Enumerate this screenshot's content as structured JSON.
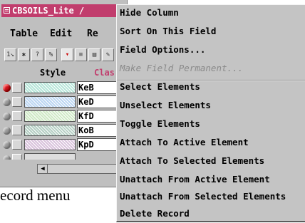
{
  "window": {
    "title": "CBSOILS_Lite /",
    "menu": [
      "Table",
      "Edit",
      "Re"
    ],
    "columns": {
      "style": "Style",
      "class": "Clas"
    },
    "rows": [
      {
        "code": "KeB",
        "selected": true,
        "color": "#b7e6d9"
      },
      {
        "code": "KeD",
        "selected": false,
        "color": "#bcd6f2"
      },
      {
        "code": "KfD",
        "selected": false,
        "color": "#cfe9c6"
      },
      {
        "code": "KoB",
        "selected": false,
        "color": "#b5cfc4"
      },
      {
        "code": "KpD",
        "selected": false,
        "color": "#d9c3dc"
      }
    ]
  },
  "caption": "ecord menu",
  "context_menu": {
    "items": [
      {
        "label": "Hide Column",
        "enabled": true
      },
      {
        "label": "Sort On This Field",
        "enabled": true
      },
      {
        "label": "Field Options...",
        "enabled": true
      },
      {
        "label": "Make Field Permanent...",
        "enabled": false
      },
      {
        "label": "Select Elements",
        "enabled": true
      },
      {
        "label": "Unselect Elements",
        "enabled": true
      },
      {
        "label": "Toggle Elements",
        "enabled": true
      },
      {
        "label": "Attach To Active Element",
        "enabled": true
      },
      {
        "label": "Attach To Selected Elements",
        "enabled": true
      },
      {
        "label": "Unattach From Active Element",
        "enabled": true
      },
      {
        "label": "Unattach From Selected Elements",
        "enabled": true
      },
      {
        "label": "Delete Record",
        "enabled": true
      }
    ]
  },
  "colors": {
    "titlebar": "#c13d6d",
    "menu_bg": "#c4c4c4",
    "selected_dot": "#d0101a"
  }
}
